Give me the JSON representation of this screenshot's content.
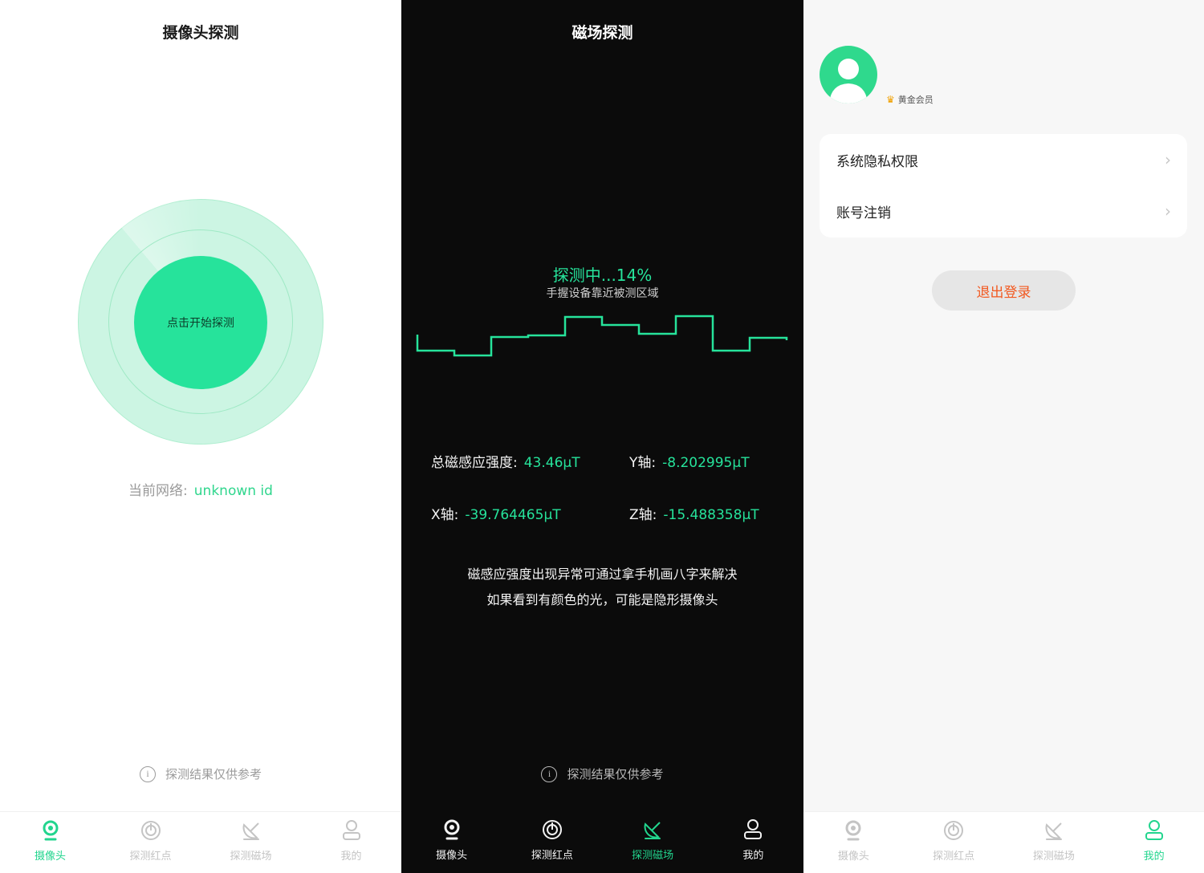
{
  "screen1": {
    "title": "摄像头探测",
    "start_button": "点击开始探测",
    "network_label": "当前网络:",
    "network_value": "unknown id",
    "disclaimer": "探测结果仅供参考"
  },
  "screen2": {
    "title": "磁场探测",
    "status": "探测中...14%",
    "hint": "手握设备靠近被测区域",
    "total_label": "总磁感应强度:",
    "total_value": "43.46μT",
    "y_label": "Y轴:",
    "y_value": "-8.202995μT",
    "x_label": "X轴:",
    "x_value": "-39.764465μT",
    "z_label": "Z轴:",
    "z_value": "-15.488358μT",
    "note_line1": "磁感应强度出现异常可通过拿手机画八字来解决",
    "note_line2": "如果看到有颜色的光，可能是隐形摄像头",
    "disclaimer": "探测结果仅供参考"
  },
  "screen3": {
    "member_badge": "黄金会员",
    "menu": [
      {
        "label": "系统隐私权限"
      },
      {
        "label": "账号注销"
      }
    ],
    "logout": "退出登录"
  },
  "tabs": [
    "摄像头",
    "探测红点",
    "探测磁场",
    "我的"
  ],
  "colors": {
    "accent": "#26e39b",
    "logout_text": "#f2581f",
    "dark_bg": "#0b0b0b"
  }
}
